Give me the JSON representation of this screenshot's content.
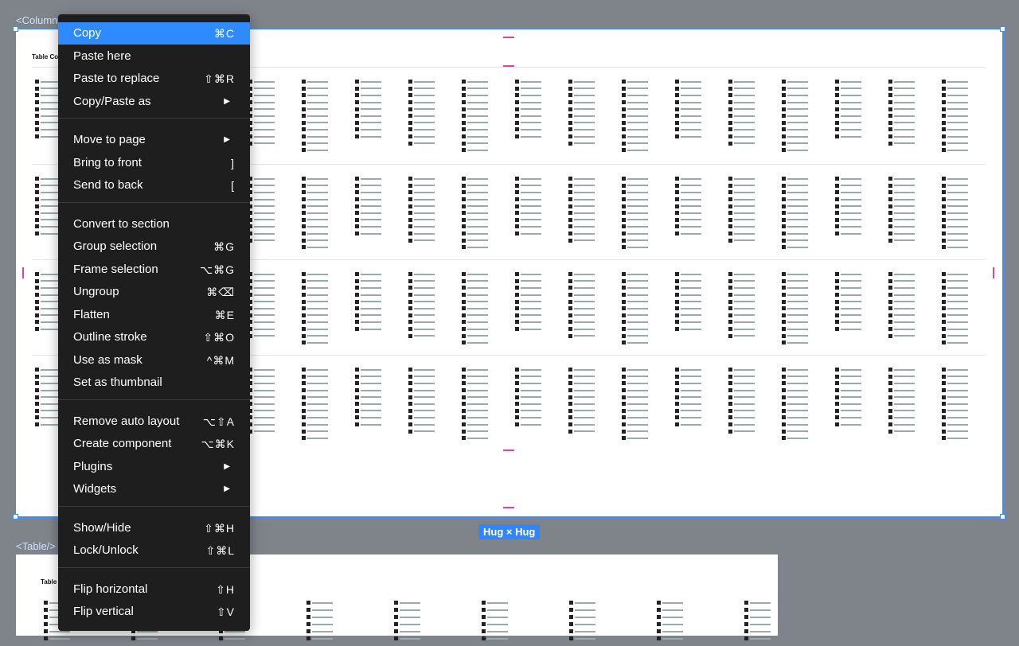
{
  "canvas": {
    "top_frame_label": "<Column",
    "bottom_frame_label": "<Table/>",
    "hug_badge": "Hug × Hug",
    "top_frame_title": "Table Col",
    "bottom_frame_title": "Table",
    "colors": {
      "canvas_bg": "#7f848b",
      "selection": "#3d8bff",
      "guide": "#e8409a"
    }
  },
  "context_menu": {
    "groups": [
      [
        {
          "label": "Copy",
          "shortcut": "⌘C",
          "active": true
        },
        {
          "label": "Paste here",
          "shortcut": ""
        },
        {
          "label": "Paste to replace",
          "shortcut": "⇧⌘R"
        },
        {
          "label": "Copy/Paste as",
          "submenu": true
        }
      ],
      [
        {
          "label": "Move to page",
          "submenu": true
        },
        {
          "label": "Bring to front",
          "shortcut": "]"
        },
        {
          "label": "Send to back",
          "shortcut": "["
        }
      ],
      [
        {
          "label": "Convert to section",
          "shortcut": ""
        },
        {
          "label": "Group selection",
          "shortcut": "⌘G"
        },
        {
          "label": "Frame selection",
          "shortcut": "⌥⌘G"
        },
        {
          "label": "Ungroup",
          "shortcut": "⌘⌫"
        },
        {
          "label": "Flatten",
          "shortcut": "⌘E"
        },
        {
          "label": "Outline stroke",
          "shortcut": "⇧⌘O"
        },
        {
          "label": "Use as mask",
          "shortcut": "^⌘M"
        },
        {
          "label": "Set as thumbnail",
          "shortcut": ""
        }
      ],
      [
        {
          "label": "Remove auto layout",
          "shortcut": "⌥⇧A"
        },
        {
          "label": "Create component",
          "shortcut": "⌥⌘K"
        },
        {
          "label": "Plugins",
          "submenu": true
        },
        {
          "label": "Widgets",
          "submenu": true
        }
      ],
      [
        {
          "label": "Show/Hide",
          "shortcut": "⇧⌘H"
        },
        {
          "label": "Lock/Unlock",
          "shortcut": "⇧⌘L"
        }
      ],
      [
        {
          "label": "Flip horizontal",
          "shortcut": "⇧H"
        },
        {
          "label": "Flip vertical",
          "shortcut": "⇧V"
        }
      ]
    ]
  }
}
